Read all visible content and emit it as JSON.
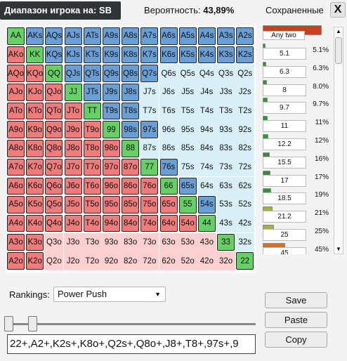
{
  "header": {
    "title": "Диапазон игрока на: SB",
    "probability_label": "Вероятность:",
    "probability_value": "43,89%",
    "saved_title": "Сохраненные",
    "close_label": "X"
  },
  "grid": {
    "rows": [
      [
        "AA",
        "AKs",
        "AQs",
        "AJs",
        "ATs",
        "A9s",
        "A8s",
        "A7s",
        "A6s",
        "A5s",
        "A4s",
        "A3s",
        "A2s"
      ],
      [
        "AKo",
        "KK",
        "KQs",
        "KJs",
        "KTs",
        "K9s",
        "K8s",
        "K7s",
        "K6s",
        "K5s",
        "K4s",
        "K3s",
        "K2s"
      ],
      [
        "AQo",
        "KQo",
        "QQ",
        "QJs",
        "QTs",
        "Q9s",
        "Q8s",
        "Q7s",
        "Q6s",
        "Q5s",
        "Q4s",
        "Q3s",
        "Q2s"
      ],
      [
        "AJo",
        "KJo",
        "QJo",
        "JJ",
        "JTs",
        "J9s",
        "J8s",
        "J7s",
        "J6s",
        "J5s",
        "J4s",
        "J3s",
        "J2s"
      ],
      [
        "ATo",
        "KTo",
        "QTo",
        "JTo",
        "TT",
        "T9s",
        "T8s",
        "T7s",
        "T6s",
        "T5s",
        "T4s",
        "T3s",
        "T2s"
      ],
      [
        "A9o",
        "K9o",
        "Q9o",
        "J9o",
        "T9o",
        "99",
        "98s",
        "97s",
        "96s",
        "95s",
        "94s",
        "93s",
        "92s"
      ],
      [
        "A8o",
        "K8o",
        "Q8o",
        "J8o",
        "T8o",
        "98o",
        "88",
        "87s",
        "86s",
        "85s",
        "84s",
        "83s",
        "82s"
      ],
      [
        "A7o",
        "K7o",
        "Q7o",
        "J7o",
        "T7o",
        "97o",
        "87o",
        "77",
        "76s",
        "75s",
        "74s",
        "73s",
        "72s"
      ],
      [
        "A6o",
        "K6o",
        "Q6o",
        "J6o",
        "T6o",
        "96o",
        "86o",
        "76o",
        "66",
        "65s",
        "64s",
        "63s",
        "62s"
      ],
      [
        "A5o",
        "K5o",
        "Q5o",
        "J5o",
        "T5o",
        "95o",
        "85o",
        "75o",
        "65o",
        "55",
        "54s",
        "53s",
        "52s"
      ],
      [
        "A4o",
        "K4o",
        "Q4o",
        "J4o",
        "T4o",
        "94o",
        "84o",
        "74o",
        "64o",
        "54o",
        "44",
        "43s",
        "42s"
      ],
      [
        "A3o",
        "K3o",
        "Q3o",
        "J3o",
        "T3o",
        "93o",
        "83o",
        "73o",
        "63o",
        "53o",
        "43o",
        "33",
        "32s"
      ],
      [
        "A2o",
        "K2o",
        "Q2o",
        "J2o",
        "T2o",
        "92o",
        "82o",
        "72o",
        "62o",
        "52o",
        "42o",
        "32o",
        "22"
      ]
    ],
    "selected_counts": [
      13,
      13,
      8,
      7,
      7,
      8,
      7,
      9,
      10,
      11,
      11,
      2,
      2
    ]
  },
  "saved": {
    "items": [
      {
        "label": "Any two",
        "pct": ""
      },
      {
        "label": "5.1",
        "pct": "5.1%"
      },
      {
        "label": "6.3",
        "pct": "6.3%"
      },
      {
        "label": "8",
        "pct": "8.0%"
      },
      {
        "label": "9.7",
        "pct": "9.7%"
      },
      {
        "label": "11",
        "pct": "11%"
      },
      {
        "label": "12.2",
        "pct": "12%"
      },
      {
        "label": "15.5",
        "pct": "16%"
      },
      {
        "label": "17",
        "pct": "17%"
      },
      {
        "label": "18.5",
        "pct": "19%"
      },
      {
        "label": "21.2",
        "pct": "21%"
      },
      {
        "label": "25",
        "pct": "25%"
      },
      {
        "label": "45",
        "pct": "45%"
      }
    ]
  },
  "controls": {
    "rankings_label": "Rankings:",
    "rankings_value": "Power Push",
    "range_text": "22+,A2+,K2s+,K8o+,Q2s+,Q8o+,J8+,T8+,97s+,9",
    "save_label": "Save",
    "paste_label": "Paste",
    "copy_label": "Copy"
  }
}
